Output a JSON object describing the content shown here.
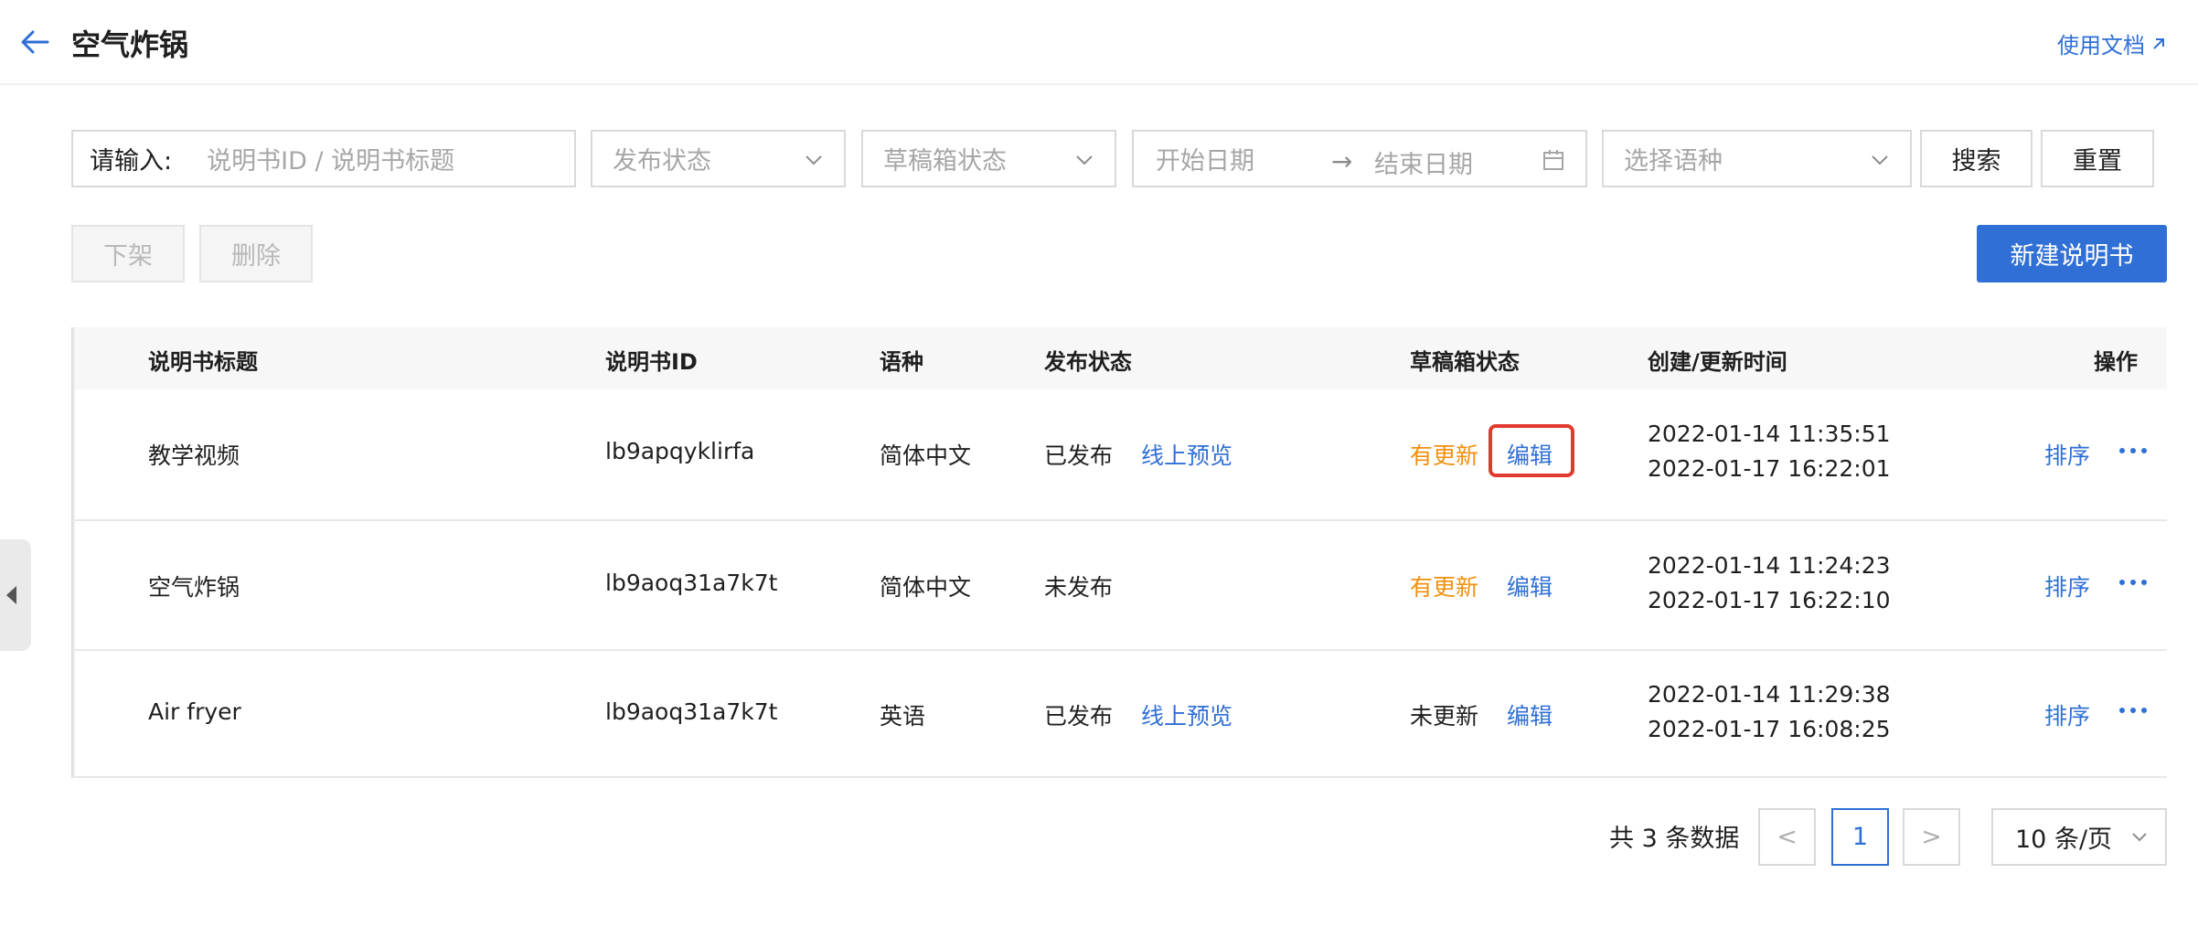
{
  "header": {
    "title": "空气炸锅",
    "doc_link": "使用文档"
  },
  "filters": {
    "input_label": "请输入:",
    "input_placeholder": "说明书ID / 说明书标题",
    "publish_status_placeholder": "发布状态",
    "draft_status_placeholder": "草稿箱状态",
    "start_date_placeholder": "开始日期",
    "date_separator": "→",
    "end_date_placeholder": "结束日期",
    "language_placeholder": "选择语种",
    "search_label": "搜索",
    "reset_label": "重置"
  },
  "actions": {
    "unpublish_label": "下架",
    "delete_label": "删除",
    "new_label": "新建说明书"
  },
  "table": {
    "columns": [
      "说明书标题",
      "说明书ID",
      "语种",
      "发布状态",
      "草稿箱状态",
      "创建/更新时间",
      "操作"
    ],
    "rows": [
      {
        "title": "教学视频",
        "id": "lb9apqyklirfa",
        "language": "简体中文",
        "publish_status": "已发布",
        "preview": "线上预览",
        "draft_status": "有更新",
        "edit": "编辑",
        "created": "2022-01-14 11:35:51",
        "updated": "2022-01-17 16:22:01",
        "sort": "排序"
      },
      {
        "title": "空气炸锅",
        "id": "lb9aoq31a7k7t",
        "language": "简体中文",
        "publish_status": "未发布",
        "preview": "",
        "draft_status": "有更新",
        "edit": "编辑",
        "created": "2022-01-14 11:24:23",
        "updated": "2022-01-17 16:22:10",
        "sort": "排序"
      },
      {
        "title": "Air fryer",
        "id": "lb9aoq31a7k7t",
        "language": "英语",
        "publish_status": "已发布",
        "preview": "线上预览",
        "draft_status": "未更新",
        "edit": "编辑",
        "created": "2022-01-14 11:29:38",
        "updated": "2022-01-17 16:08:25",
        "sort": "排序"
      }
    ]
  },
  "pagination": {
    "total_text": "共 3 条数据",
    "current_page": "1",
    "prev": "<",
    "next": ">",
    "page_size": "10 条/页"
  },
  "colors": {
    "primary": "#2f6fd6",
    "warning": "#f0900d",
    "highlight": "#e23a2e"
  }
}
